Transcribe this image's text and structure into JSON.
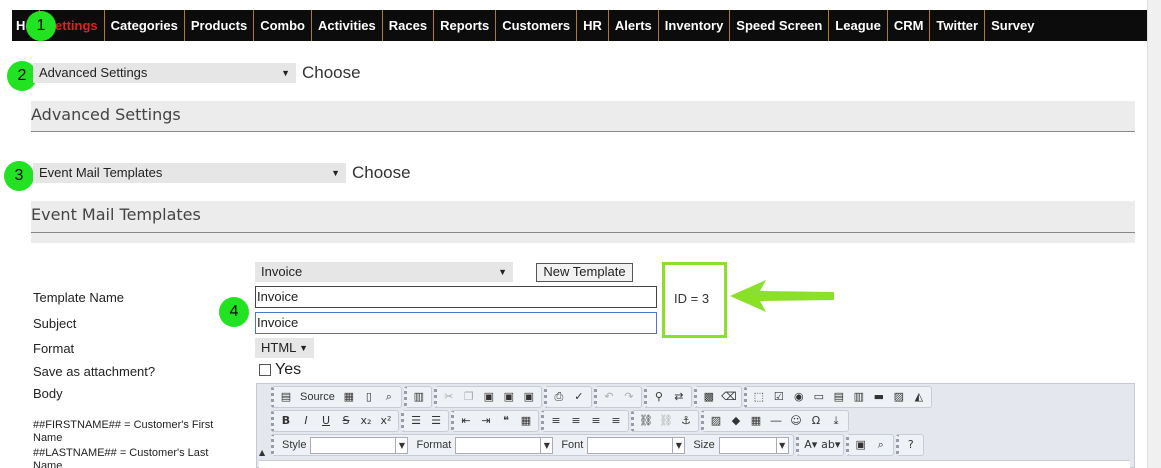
{
  "nav": {
    "items": [
      "Ho",
      "Settings",
      "Categories",
      "Products",
      "Combo",
      "Activities",
      "Races",
      "Reports",
      "Customers",
      "HR",
      "Alerts",
      "Inventory",
      "Speed Screen",
      "League",
      "CRM",
      "Twitter",
      "Survey"
    ],
    "active": "Settings",
    "active_color": "#e02020"
  },
  "badges": [
    "1",
    "2",
    "3",
    "4"
  ],
  "advanced": {
    "select_value": "Advanced Settings",
    "choose_label": "Choose",
    "section_title": "Advanced Settings"
  },
  "event_mail": {
    "select_value": "Event Mail Templates",
    "choose_label": "Choose",
    "section_title": "Event Mail Templates"
  },
  "form": {
    "template_select_value": "Invoice",
    "new_template_label": "New Template",
    "template_name_label": "Template Name",
    "template_name_value": "Invoice",
    "subject_label": "Subject",
    "subject_value": "Invoice",
    "format_label": "Format",
    "format_value": "HTML",
    "attachment_label": "Save as attachment?",
    "attachment_option": "Yes",
    "body_label": "Body",
    "id_text": "ID = 3",
    "help_lines": [
      "##FIRSTNAME## = Customer's First Name",
      "##LASTNAME## = Customer's Last Name"
    ]
  },
  "editor": {
    "source_label": "Source",
    "style_label": "Style",
    "format_label": "Format",
    "font_label": "Font",
    "size_label": "Size"
  },
  "colors": {
    "badge": "#22e322",
    "highlight": "#8be02a",
    "arrow": "#8be02a"
  }
}
